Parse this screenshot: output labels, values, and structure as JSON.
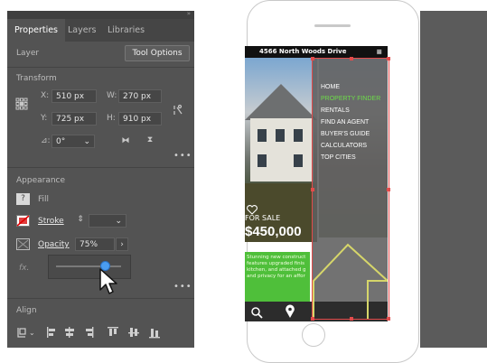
{
  "panel": {
    "tabs": [
      {
        "label": "Properties",
        "active": true
      },
      {
        "label": "Layers",
        "active": false
      },
      {
        "label": "Libraries",
        "active": false
      }
    ],
    "collapse_glyph": "»",
    "layer": {
      "label": "Layer",
      "button": "Tool Options"
    },
    "transform": {
      "title": "Transform",
      "x_label": "X:",
      "x_value": "510 px",
      "y_label": "Y:",
      "y_value": "725 px",
      "w_label": "W:",
      "w_value": "270 px",
      "h_label": "H:",
      "h_value": "910 px",
      "angle_label": "⊿:",
      "angle_value": "0°",
      "more": "•••"
    },
    "appearance": {
      "title": "Appearance",
      "fill_label": "Fill",
      "stroke_label": "Stroke",
      "opacity_label": "Opacity",
      "opacity_value": "75%",
      "opacity_slider_fraction": 0.75,
      "fx_label": "fx.",
      "more": "•••"
    },
    "align": {
      "title": "Align"
    }
  },
  "artboard": {
    "address": "4566 North Woods Drive",
    "menu_items": [
      {
        "label": "HOME",
        "color": "#ffffff"
      },
      {
        "label": "PROPERTY FINDER",
        "color": "#6ddc4a"
      },
      {
        "label": "RENTALS",
        "color": "#ffffff"
      },
      {
        "label": "FIND AN AGENT",
        "color": "#ffffff"
      },
      {
        "label": "BUYER'S GUIDE",
        "color": "#ffffff"
      },
      {
        "label": "CALCULATORS",
        "color": "#ffffff"
      },
      {
        "label": "TOP CITIES",
        "color": "#ffffff"
      }
    ],
    "for_sale": "FOR SALE",
    "price": "$450,000",
    "blurb_lines": [
      "Stunning new construct",
      "features upgraded finis",
      "kitchen, and attached g",
      "and privacy for an affor"
    ]
  },
  "colors": {
    "accent_green": "#4fbf3a",
    "selection_red": "#e24b4b",
    "slider_blue": "#4a9cf0"
  }
}
